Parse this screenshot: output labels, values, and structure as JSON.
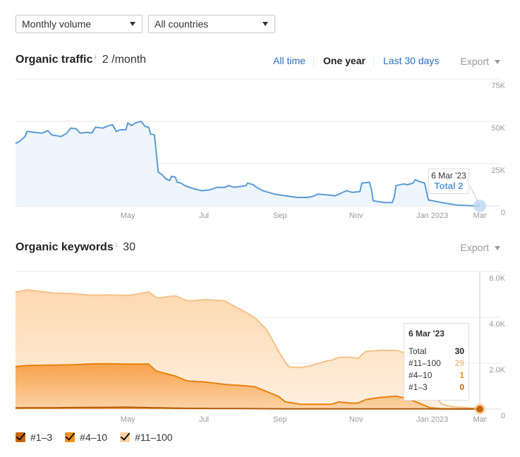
{
  "filters": {
    "volume_select": "Monthly volume",
    "country_select": "All countries"
  },
  "traffic": {
    "title": "Organic traffic",
    "info_icon": "i",
    "value": "2 /month",
    "ranges": [
      "All time",
      "One year",
      "Last 30 days"
    ],
    "active_range": "One year",
    "export_label": "Export",
    "tooltip": {
      "date": "6 Mar '23",
      "label": "Total 2"
    },
    "colors": {
      "line": "#5b9bd5",
      "fill": "#eef5fd",
      "marker": "#bcd7f3"
    }
  },
  "keywords": {
    "title": "Organic keywords",
    "info_icon": "i",
    "value": "30",
    "export_label": "Export",
    "tooltip": {
      "date": "6 Mar '23",
      "rows": [
        {
          "label": "Total",
          "value": "30",
          "color": "#222222"
        },
        {
          "label": "#11–100",
          "value": "29",
          "color": "#f5c48d"
        },
        {
          "label": "#4–10",
          "value": "1",
          "color": "#f0961e"
        },
        {
          "label": "#1–3",
          "value": "0",
          "color": "#c8660a"
        }
      ]
    },
    "legend": [
      {
        "label": "#1–3",
        "color": "#c8660a",
        "checked": true
      },
      {
        "label": "#4–10",
        "color": "#f0901c",
        "checked": true
      },
      {
        "label": "#11–100",
        "color": "#fbd2a4",
        "checked": true
      }
    ]
  },
  "chart_data": [
    {
      "type": "area",
      "title": "Organic traffic",
      "x_ticks": [
        "May",
        "Jul",
        "Sep",
        "Nov",
        "Jan 2023",
        "Mar"
      ],
      "y_ticks": [
        "0",
        "25K",
        "50K",
        "75K"
      ],
      "ylim": [
        0,
        75000
      ],
      "x_range_months": [
        2.0,
        14.2
      ],
      "grid": true,
      "series": [
        {
          "name": "Organic traffic",
          "points": [
            [
              2.0,
              37000
            ],
            [
              2.1,
              38000
            ],
            [
              2.25,
              41000
            ],
            [
              2.3,
              44000
            ],
            [
              2.5,
              43500
            ],
            [
              2.7,
              43000
            ],
            [
              2.85,
              44500
            ],
            [
              2.95,
              42000
            ],
            [
              3.2,
              41000
            ],
            [
              3.35,
              43000
            ],
            [
              3.45,
              46000
            ],
            [
              3.6,
              45500
            ],
            [
              3.7,
              43000
            ],
            [
              3.9,
              43500
            ],
            [
              4.0,
              43000
            ],
            [
              4.1,
              46500
            ],
            [
              4.3,
              46000
            ],
            [
              4.4,
              47000
            ],
            [
              4.55,
              48000
            ],
            [
              4.65,
              44000
            ],
            [
              4.75,
              45000
            ],
            [
              4.9,
              45000
            ],
            [
              4.95,
              49000
            ],
            [
              5.05,
              47500
            ],
            [
              5.15,
              49000
            ],
            [
              5.3,
              50000
            ],
            [
              5.4,
              47000
            ],
            [
              5.5,
              46500
            ],
            [
              5.55,
              42500
            ],
            [
              5.65,
              42000
            ],
            [
              5.75,
              20000
            ],
            [
              5.85,
              18500
            ],
            [
              5.95,
              16000
            ],
            [
              6.05,
              15000
            ],
            [
              6.1,
              17500
            ],
            [
              6.2,
              17000
            ],
            [
              6.25,
              14000
            ],
            [
              6.35,
              13500
            ],
            [
              6.45,
              12000
            ],
            [
              6.7,
              10000
            ],
            [
              6.9,
              9000
            ],
            [
              7.1,
              9500
            ],
            [
              7.3,
              11000
            ],
            [
              7.5,
              11000
            ],
            [
              7.6,
              12000
            ],
            [
              7.75,
              11000
            ],
            [
              7.9,
              11500
            ],
            [
              8.05,
              12000
            ],
            [
              8.1,
              13500
            ],
            [
              8.25,
              12500
            ],
            [
              8.3,
              11500
            ],
            [
              8.5,
              9000
            ],
            [
              8.8,
              7000
            ],
            [
              9.1,
              6000
            ],
            [
              9.4,
              5000
            ],
            [
              9.65,
              5000
            ],
            [
              9.8,
              5500
            ],
            [
              9.95,
              7000
            ],
            [
              10.2,
              6500
            ],
            [
              10.4,
              6000
            ],
            [
              10.55,
              7500
            ],
            [
              10.7,
              9000
            ],
            [
              10.85,
              8000
            ],
            [
              11.05,
              8500
            ],
            [
              11.1,
              13500
            ],
            [
              11.3,
              14000
            ],
            [
              11.35,
              10000
            ],
            [
              11.4,
              3000
            ],
            [
              11.55,
              2500
            ],
            [
              11.7,
              2000
            ],
            [
              11.9,
              2000
            ],
            [
              11.95,
              5000
            ],
            [
              12.0,
              12000
            ],
            [
              12.2,
              13000
            ],
            [
              12.3,
              12500
            ],
            [
              12.45,
              13500
            ],
            [
              12.5,
              15500
            ],
            [
              12.6,
              14500
            ],
            [
              12.75,
              13500
            ],
            [
              12.85,
              3500
            ],
            [
              13.2,
              2000
            ],
            [
              13.6,
              500
            ],
            [
              13.9,
              200
            ],
            [
              14.2,
              2
            ]
          ]
        }
      ],
      "annotation": {
        "date": "6 Mar '23",
        "text": "Total 2"
      }
    },
    {
      "type": "area",
      "stacked": true,
      "title": "Organic keywords",
      "x_ticks": [
        "May",
        "Jul",
        "Sep",
        "Nov",
        "Jan 2023",
        "Mar"
      ],
      "y_ticks": [
        "0",
        "2.0K",
        "4.0K",
        "6.0K"
      ],
      "ylim": [
        0,
        6000
      ],
      "x_range_months": [
        2.0,
        14.2
      ],
      "grid": true,
      "legend_position": "bottom-left",
      "series": [
        {
          "name": "#1–3",
          "points": [
            [
              2.0,
              50
            ],
            [
              3.0,
              55
            ],
            [
              4.0,
              70
            ],
            [
              5.0,
              80
            ],
            [
              5.5,
              60
            ],
            [
              6.5,
              30
            ],
            [
              8.0,
              20
            ],
            [
              9.0,
              10
            ],
            [
              11.0,
              10
            ],
            [
              12.5,
              10
            ],
            [
              13.0,
              5
            ],
            [
              14.2,
              0
            ]
          ]
        },
        {
          "name": "#4–10",
          "points": [
            [
              2.0,
              1800
            ],
            [
              2.3,
              1850
            ],
            [
              3.0,
              1860
            ],
            [
              3.5,
              1870
            ],
            [
              4.0,
              1900
            ],
            [
              4.5,
              1900
            ],
            [
              5.0,
              1880
            ],
            [
              5.5,
              1900
            ],
            [
              5.7,
              1600
            ],
            [
              6.2,
              1400
            ],
            [
              6.5,
              1200
            ],
            [
              7.0,
              1150
            ],
            [
              7.5,
              1050
            ],
            [
              8.0,
              1000
            ],
            [
              8.3,
              950
            ],
            [
              8.6,
              750
            ],
            [
              8.9,
              550
            ],
            [
              9.1,
              300
            ],
            [
              9.5,
              200
            ],
            [
              10.0,
              200
            ],
            [
              10.3,
              200
            ],
            [
              10.5,
              300
            ],
            [
              10.8,
              250
            ],
            [
              11.0,
              250
            ],
            [
              11.2,
              400
            ],
            [
              11.6,
              500
            ],
            [
              12.0,
              550
            ],
            [
              12.3,
              450
            ],
            [
              12.6,
              250
            ],
            [
              12.9,
              50
            ],
            [
              13.2,
              10
            ],
            [
              14.2,
              1
            ]
          ]
        },
        {
          "name": "#11–100",
          "points": [
            [
              2.0,
              3250
            ],
            [
              2.3,
              3300
            ],
            [
              3.0,
              3150
            ],
            [
              3.5,
              3100
            ],
            [
              4.0,
              3000
            ],
            [
              4.5,
              3000
            ],
            [
              5.0,
              3000
            ],
            [
              5.5,
              3150
            ],
            [
              5.8,
              3250
            ],
            [
              6.2,
              3500
            ],
            [
              6.6,
              3500
            ],
            [
              7.0,
              3600
            ],
            [
              7.5,
              3650
            ],
            [
              7.8,
              3400
            ],
            [
              8.0,
              3250
            ],
            [
              8.3,
              3000
            ],
            [
              8.6,
              2700
            ],
            [
              8.9,
              2000
            ],
            [
              9.2,
              1550
            ],
            [
              9.5,
              1600
            ],
            [
              9.8,
              1700
            ],
            [
              10.2,
              1900
            ],
            [
              10.5,
              1950
            ],
            [
              10.8,
              2000
            ],
            [
              11.0,
              1950
            ],
            [
              11.2,
              2100
            ],
            [
              11.6,
              2050
            ],
            [
              12.0,
              2000
            ],
            [
              12.3,
              1950
            ],
            [
              12.6,
              1450
            ],
            [
              12.9,
              750
            ],
            [
              13.2,
              200
            ],
            [
              13.5,
              80
            ],
            [
              14.2,
              29
            ]
          ]
        }
      ],
      "annotation": {
        "date": "6 Mar '23",
        "values": {
          "Total": 30,
          "#11–100": 29,
          "#4–10": 1,
          "#1–3": 0
        }
      }
    }
  ]
}
